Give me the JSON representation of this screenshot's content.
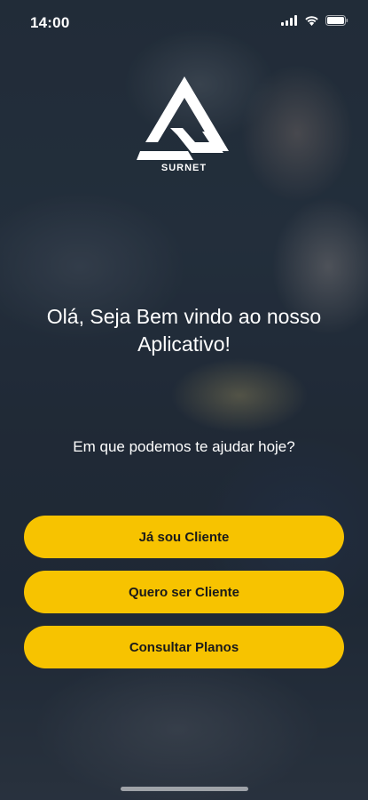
{
  "status_bar": {
    "time": "14:00",
    "icons": [
      "cellular-signal-icon",
      "wifi-icon",
      "battery-icon"
    ]
  },
  "brand": {
    "name": "SURNET",
    "logo_icon": "triangle-logo-icon",
    "accent_color": "#f7c300"
  },
  "welcome_text": "Olá, Seja Bem vindo ao nosso Aplicativo!",
  "help_text": "Em que podemos te ajudar hoje?",
  "buttons": {
    "already_client": "Já sou Cliente",
    "want_client": "Quero ser Cliente",
    "plans": "Consultar Planos"
  }
}
